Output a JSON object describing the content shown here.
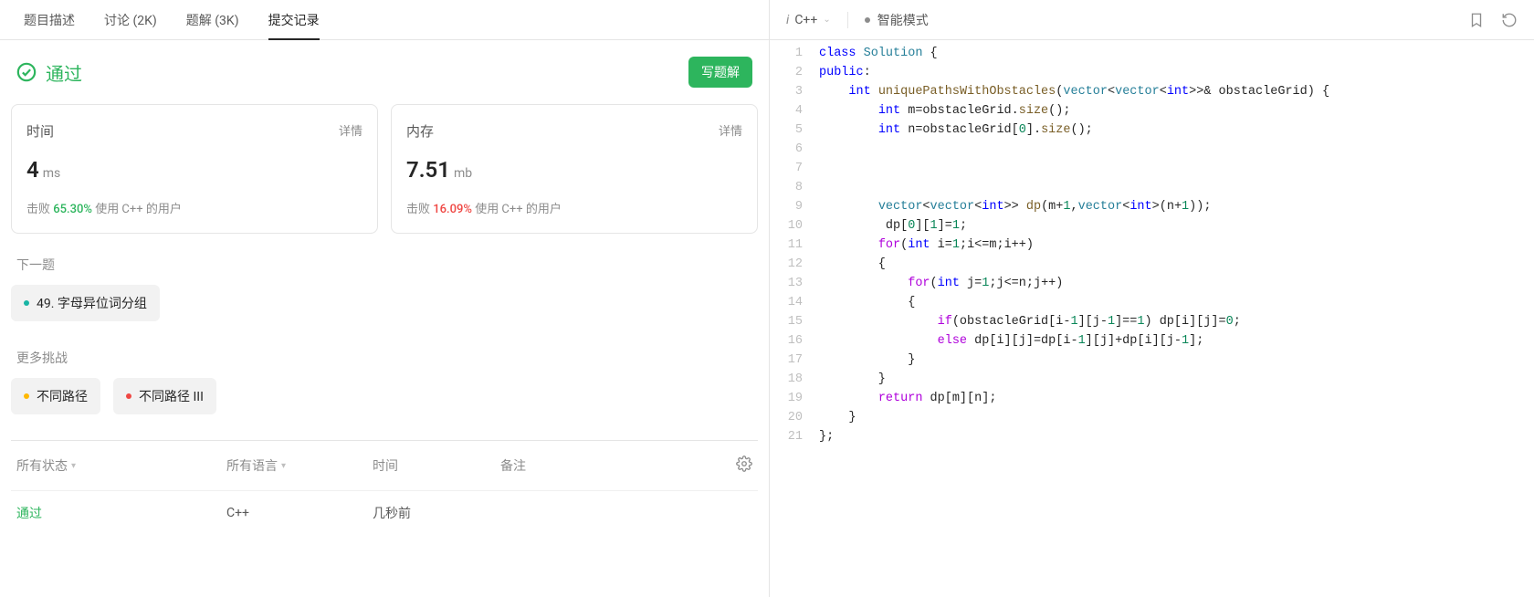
{
  "tabs": {
    "description": "题目描述",
    "discussion": "讨论 (2K)",
    "solutions": "题解 (3K)",
    "submissions": "提交记录"
  },
  "result": {
    "status_text": "通过",
    "write_solution": "写题解"
  },
  "time_card": {
    "title": "时间",
    "details": "详情",
    "value": "4",
    "unit": "ms",
    "beats_prefix": "击败 ",
    "beats_pct": "65.30%",
    "beats_suffix": " 使用 C++ 的用户"
  },
  "memory_card": {
    "title": "内存",
    "details": "详情",
    "value": "7.51",
    "unit": "mb",
    "beats_prefix": "击败 ",
    "beats_pct": "16.09%",
    "beats_suffix": " 使用 C++ 的用户"
  },
  "next": {
    "section": "下一题",
    "label": "49. 字母异位词分组"
  },
  "more": {
    "section": "更多挑战",
    "item1": "不同路径",
    "item2": "不同路径 III"
  },
  "table": {
    "status_header": "所有状态",
    "lang_header": "所有语言",
    "time_header": "时间",
    "note_header": "备注",
    "row1": {
      "status": "通过",
      "lang": "C++",
      "time": "几秒前"
    }
  },
  "editor": {
    "lang": "C++",
    "smart_mode": "智能模式"
  },
  "code_lines": [
    "1",
    "2",
    "3",
    "4",
    "5",
    "6",
    "7",
    "8",
    "9",
    "10",
    "11",
    "12",
    "13",
    "14",
    "15",
    "16",
    "17",
    "18",
    "19",
    "20",
    "21"
  ]
}
